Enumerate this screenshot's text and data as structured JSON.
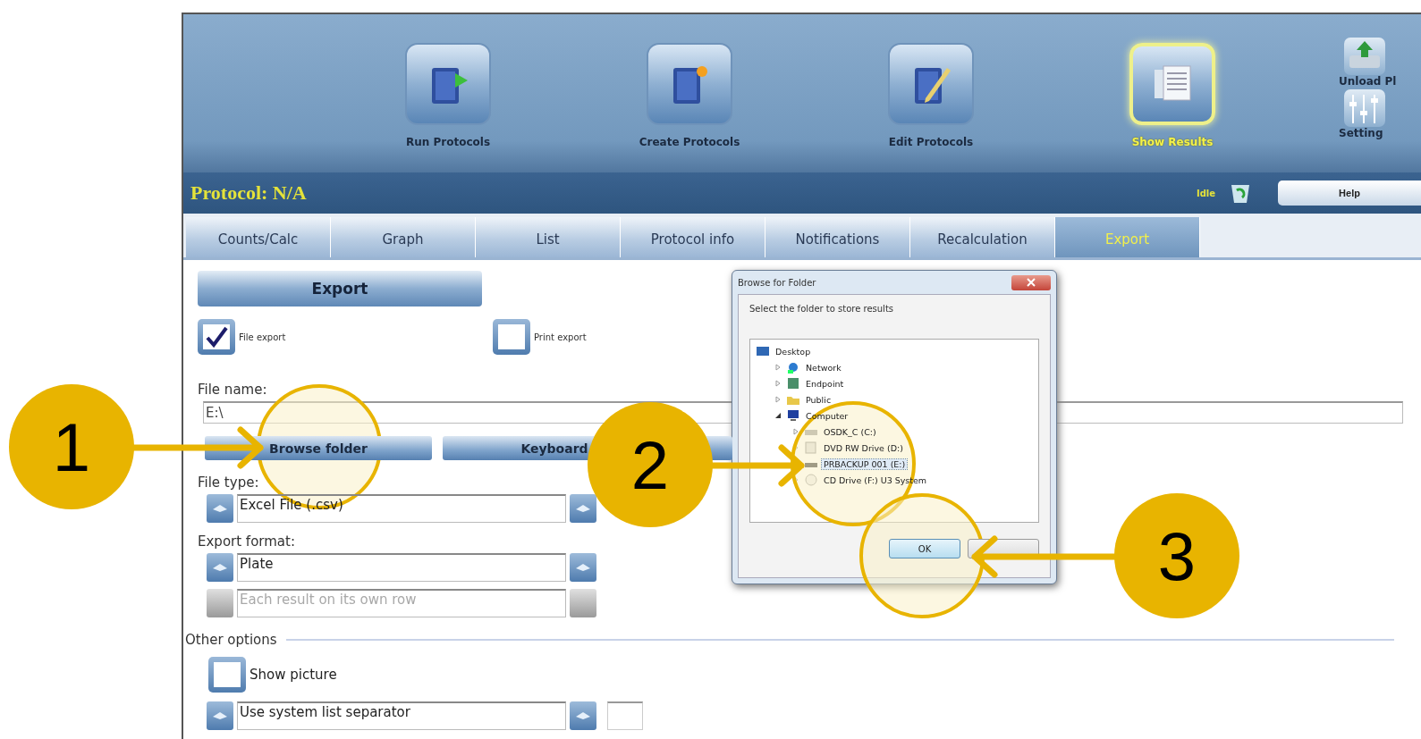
{
  "toolbar": {
    "items": [
      {
        "label": "Run Protocols",
        "kind": "run",
        "selected": false
      },
      {
        "label": "Create Protocols",
        "kind": "create",
        "selected": false
      },
      {
        "label": "Edit Protocols",
        "kind": "edit",
        "selected": false
      },
      {
        "label": "Show Results",
        "kind": "results",
        "selected": true
      }
    ],
    "side_items": [
      {
        "label": "Unload Pl",
        "kind": "unload"
      },
      {
        "label": "Setting",
        "kind": "settings"
      }
    ]
  },
  "protocol_bar": {
    "title": "Protocol: N/A",
    "status": "Idle",
    "help": "Help"
  },
  "tabs": [
    {
      "label": "Counts/Calc",
      "selected": false
    },
    {
      "label": "Graph",
      "selected": false
    },
    {
      "label": "List",
      "selected": false
    },
    {
      "label": "Protocol info",
      "selected": false
    },
    {
      "label": "Notifications",
      "selected": false
    },
    {
      "label": "Recalculation",
      "selected": false
    },
    {
      "label": "Export",
      "selected": true
    }
  ],
  "export": {
    "header": "Export",
    "checkboxes": [
      {
        "label": "File export",
        "checked": true
      },
      {
        "label": "Print export",
        "checked": false
      }
    ],
    "file_name_label": "File name:",
    "file_name": "E:\\",
    "buttons": [
      "Browse folder",
      "Keyboard"
    ],
    "file_type_label": "File type:",
    "file_type": {
      "value": "Excel File (.csv)",
      "disabled": false
    },
    "export_format_label": "Export format:",
    "formats": [
      {
        "value": "Plate",
        "disabled": false
      },
      {
        "value": "Each result on its own row",
        "disabled": true
      }
    ],
    "other_options_label": "Other options",
    "show_picture": {
      "label": "Show picture",
      "checked": false
    },
    "separator": {
      "value": "Use system list separator",
      "disabled": false
    }
  },
  "dialog": {
    "title": "Browse for Folder",
    "prompt": "Select the folder to store results",
    "ok": "OK",
    "tree": [
      {
        "label": "Desktop",
        "kind": "desktop",
        "selected": false,
        "children": [
          {
            "label": "Network",
            "kind": "network",
            "expanded": false,
            "selected": false
          },
          {
            "label": "Endpoint",
            "kind": "user",
            "expanded": false,
            "selected": false
          },
          {
            "label": "Public",
            "kind": "folder",
            "expanded": false,
            "selected": false
          },
          {
            "label": "Computer",
            "kind": "computer",
            "expanded": true,
            "selected": false,
            "children": [
              {
                "label": "OSDK_C (C:)",
                "kind": "drive",
                "expanded": false,
                "selected": false
              },
              {
                "label": "DVD RW Drive (D:)",
                "kind": "dvd",
                "expanded": false,
                "selected": false
              },
              {
                "label": "PRBACKUP 001 (E:)",
                "kind": "usb",
                "expanded": false,
                "selected": true
              },
              {
                "label": "CD Drive (F:) U3 System",
                "kind": "cd",
                "expanded": false,
                "selected": false
              }
            ]
          }
        ]
      }
    ]
  },
  "callouts": [
    {
      "number": "1"
    },
    {
      "number": "2"
    },
    {
      "number": "3"
    }
  ]
}
